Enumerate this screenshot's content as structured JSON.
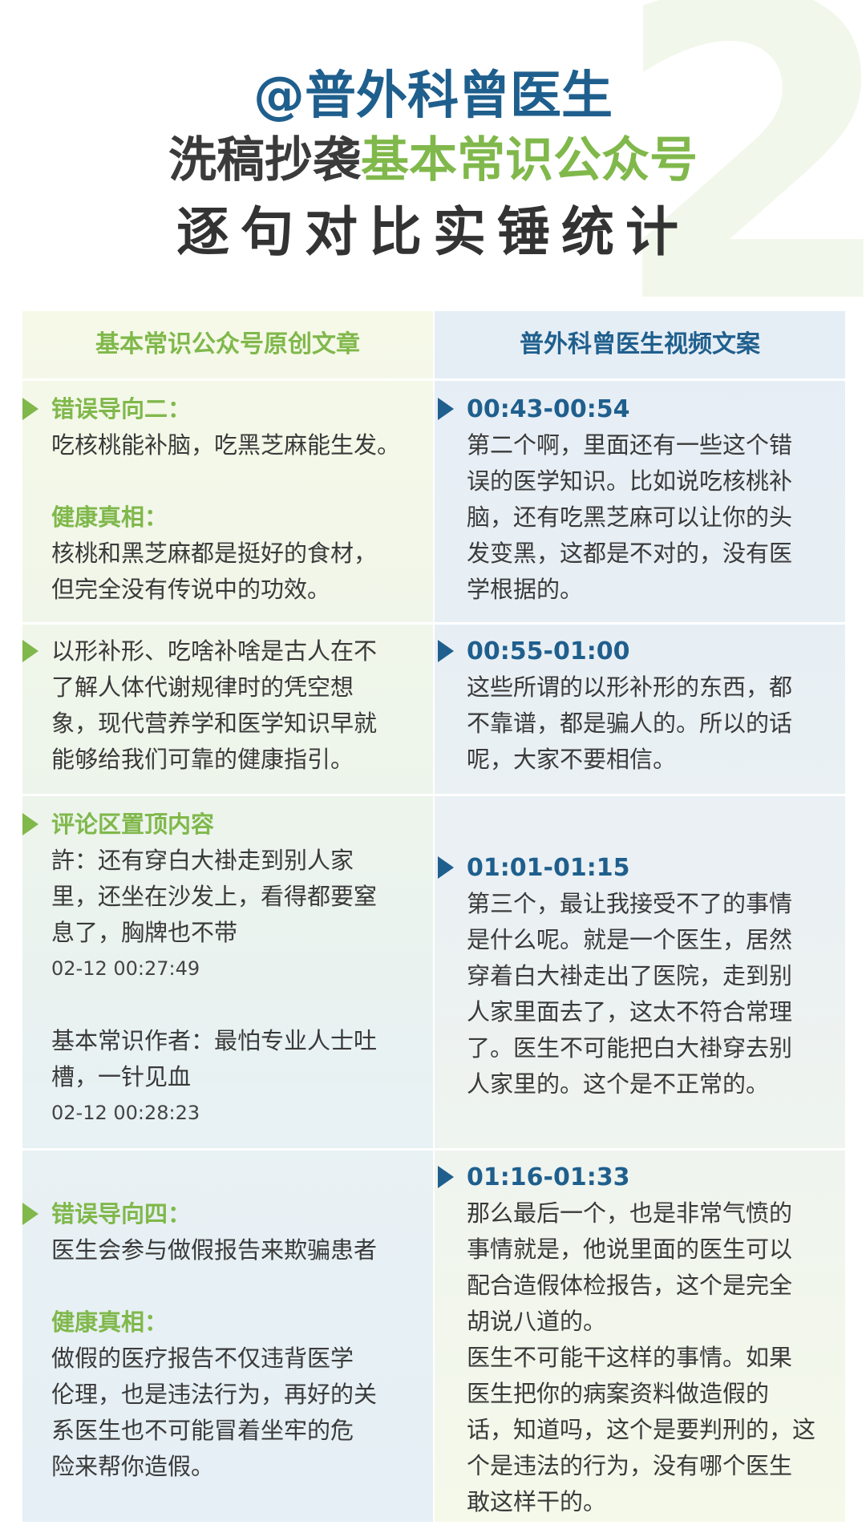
{
  "header": {
    "big_number": "2",
    "line1": "@普外科曾医生",
    "line2_prefix": "洗稿抄袭",
    "line2_highlight": "基本常识公众号",
    "line3": "逐句对比实锤统计"
  },
  "table": {
    "left_header": "基本常识公众号原创文章",
    "right_header": "普外科曾医生视频文案",
    "rows": [
      {
        "left": {
          "label1": "错误导向二：",
          "text1": "吃核桃能补脑，吃黑芝麻能生发。",
          "label2": "健康真相：",
          "text2": "核桃和黑芝麻都是挺好的食材，\n但完全没有传说中的功效。"
        },
        "right": {
          "time": "00:43-00:54",
          "text": "第二个啊，里面还有一些这个错\n误的医学知识。比如说吃核桃补\n脑，还有吃黑芝麻可以让你的头\n发变黑，这都是不对的，没有医\n学根据的。"
        }
      },
      {
        "left": {
          "text1": "以形补形、吃啥补啥是古人在不\n了解人体代谢规律时的凭空想\n象，现代营养学和医学知识早就\n能够给我们可靠的健康指引。"
        },
        "right": {
          "time": "00:55-01:00",
          "text": "这些所谓的以形补形的东西，都\n不靠谱，都是骗人的。所以的话\n呢，大家不要相信。"
        }
      },
      {
        "left": {
          "label1": "评论区置顶内容",
          "text1": "許：还有穿白大褂走到别人家\n里，还坐在沙发上，看得都要窒\n息了，胸牌也不带",
          "ts1": "02-12 00:27:49",
          "text2": "基本常识作者：最怕专业人士吐\n槽，一针见血",
          "ts2": "02-12 00:28:23"
        },
        "right": {
          "time": "01:01-01:15",
          "text": "第三个，最让我接受不了的事情\n是什么呢。就是一个医生，居然\n穿着白大褂走出了医院，走到别\n人家里面去了，这太不符合常理\n了。医生不可能把白大褂穿去别\n人家里的。这个是不正常的。"
        }
      },
      {
        "left": {
          "label1": "错误导向四：",
          "text1": "医生会参与做假报告来欺骗患者",
          "label2": "健康真相：",
          "text2": "做假的医疗报告不仅违背医学\n伦理，也是违法行为，再好的关\n系医生也不可能冒着坐牢的危\n险来帮你造假。"
        },
        "right": {
          "time": "01:16-01:33",
          "text": "那么最后一个，也是非常气愤的\n事情就是，他说里面的医生可以\n配合造假体检报告，这个是完全\n胡说八道的。\n医生不可能干这样的事情。如果\n医生把你的病案资料做造假的\n话，知道吗，这个是要判刑的，这\n个是违法的行为，没有哪个医生\n敢这样干的。"
        }
      }
    ]
  },
  "colors": {
    "blue": "#1f5f8d",
    "green": "#80b84b",
    "text": "#3a3a3a"
  }
}
